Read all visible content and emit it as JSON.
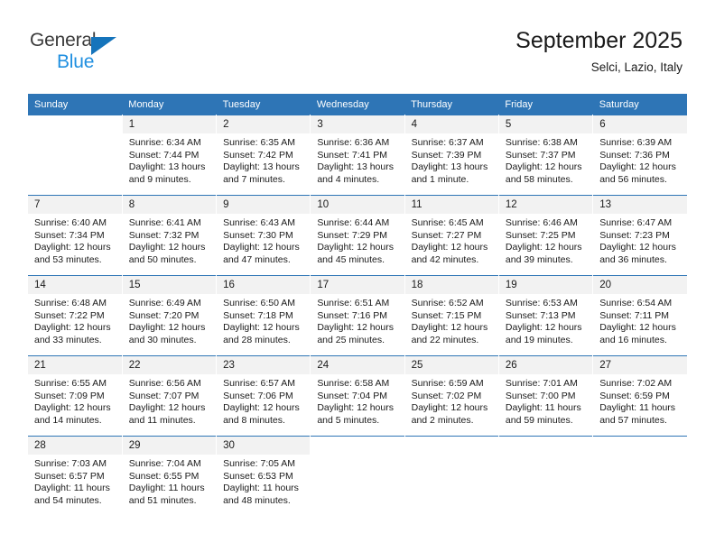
{
  "brand": {
    "name_top": "General",
    "name_bottom": "Blue",
    "accent_color": "#1574bb",
    "blue_text_color": "#1f8fe0"
  },
  "header": {
    "title": "September 2025",
    "subtitle": "Selci, Lazio, Italy"
  },
  "theme": {
    "header_bg": "#2e75b6",
    "daynum_bg": "#f2f2f2",
    "text": "#1a1a1a"
  },
  "weekday_headers": [
    "Sunday",
    "Monday",
    "Tuesday",
    "Wednesday",
    "Thursday",
    "Friday",
    "Saturday"
  ],
  "weeks": [
    [
      {
        "day": "",
        "sunrise": "",
        "sunset": "",
        "daylight_1": "",
        "daylight_2": "",
        "blank": true
      },
      {
        "day": "1",
        "sunrise": "Sunrise: 6:34 AM",
        "sunset": "Sunset: 7:44 PM",
        "daylight_1": "Daylight: 13 hours",
        "daylight_2": "and 9 minutes."
      },
      {
        "day": "2",
        "sunrise": "Sunrise: 6:35 AM",
        "sunset": "Sunset: 7:42 PM",
        "daylight_1": "Daylight: 13 hours",
        "daylight_2": "and 7 minutes."
      },
      {
        "day": "3",
        "sunrise": "Sunrise: 6:36 AM",
        "sunset": "Sunset: 7:41 PM",
        "daylight_1": "Daylight: 13 hours",
        "daylight_2": "and 4 minutes."
      },
      {
        "day": "4",
        "sunrise": "Sunrise: 6:37 AM",
        "sunset": "Sunset: 7:39 PM",
        "daylight_1": "Daylight: 13 hours",
        "daylight_2": "and 1 minute."
      },
      {
        "day": "5",
        "sunrise": "Sunrise: 6:38 AM",
        "sunset": "Sunset: 7:37 PM",
        "daylight_1": "Daylight: 12 hours",
        "daylight_2": "and 58 minutes."
      },
      {
        "day": "6",
        "sunrise": "Sunrise: 6:39 AM",
        "sunset": "Sunset: 7:36 PM",
        "daylight_1": "Daylight: 12 hours",
        "daylight_2": "and 56 minutes."
      }
    ],
    [
      {
        "day": "7",
        "sunrise": "Sunrise: 6:40 AM",
        "sunset": "Sunset: 7:34 PM",
        "daylight_1": "Daylight: 12 hours",
        "daylight_2": "and 53 minutes."
      },
      {
        "day": "8",
        "sunrise": "Sunrise: 6:41 AM",
        "sunset": "Sunset: 7:32 PM",
        "daylight_1": "Daylight: 12 hours",
        "daylight_2": "and 50 minutes."
      },
      {
        "day": "9",
        "sunrise": "Sunrise: 6:43 AM",
        "sunset": "Sunset: 7:30 PM",
        "daylight_1": "Daylight: 12 hours",
        "daylight_2": "and 47 minutes."
      },
      {
        "day": "10",
        "sunrise": "Sunrise: 6:44 AM",
        "sunset": "Sunset: 7:29 PM",
        "daylight_1": "Daylight: 12 hours",
        "daylight_2": "and 45 minutes."
      },
      {
        "day": "11",
        "sunrise": "Sunrise: 6:45 AM",
        "sunset": "Sunset: 7:27 PM",
        "daylight_1": "Daylight: 12 hours",
        "daylight_2": "and 42 minutes."
      },
      {
        "day": "12",
        "sunrise": "Sunrise: 6:46 AM",
        "sunset": "Sunset: 7:25 PM",
        "daylight_1": "Daylight: 12 hours",
        "daylight_2": "and 39 minutes."
      },
      {
        "day": "13",
        "sunrise": "Sunrise: 6:47 AM",
        "sunset": "Sunset: 7:23 PM",
        "daylight_1": "Daylight: 12 hours",
        "daylight_2": "and 36 minutes."
      }
    ],
    [
      {
        "day": "14",
        "sunrise": "Sunrise: 6:48 AM",
        "sunset": "Sunset: 7:22 PM",
        "daylight_1": "Daylight: 12 hours",
        "daylight_2": "and 33 minutes."
      },
      {
        "day": "15",
        "sunrise": "Sunrise: 6:49 AM",
        "sunset": "Sunset: 7:20 PM",
        "daylight_1": "Daylight: 12 hours",
        "daylight_2": "and 30 minutes."
      },
      {
        "day": "16",
        "sunrise": "Sunrise: 6:50 AM",
        "sunset": "Sunset: 7:18 PM",
        "daylight_1": "Daylight: 12 hours",
        "daylight_2": "and 28 minutes."
      },
      {
        "day": "17",
        "sunrise": "Sunrise: 6:51 AM",
        "sunset": "Sunset: 7:16 PM",
        "daylight_1": "Daylight: 12 hours",
        "daylight_2": "and 25 minutes."
      },
      {
        "day": "18",
        "sunrise": "Sunrise: 6:52 AM",
        "sunset": "Sunset: 7:15 PM",
        "daylight_1": "Daylight: 12 hours",
        "daylight_2": "and 22 minutes."
      },
      {
        "day": "19",
        "sunrise": "Sunrise: 6:53 AM",
        "sunset": "Sunset: 7:13 PM",
        "daylight_1": "Daylight: 12 hours",
        "daylight_2": "and 19 minutes."
      },
      {
        "day": "20",
        "sunrise": "Sunrise: 6:54 AM",
        "sunset": "Sunset: 7:11 PM",
        "daylight_1": "Daylight: 12 hours",
        "daylight_2": "and 16 minutes."
      }
    ],
    [
      {
        "day": "21",
        "sunrise": "Sunrise: 6:55 AM",
        "sunset": "Sunset: 7:09 PM",
        "daylight_1": "Daylight: 12 hours",
        "daylight_2": "and 14 minutes."
      },
      {
        "day": "22",
        "sunrise": "Sunrise: 6:56 AM",
        "sunset": "Sunset: 7:07 PM",
        "daylight_1": "Daylight: 12 hours",
        "daylight_2": "and 11 minutes."
      },
      {
        "day": "23",
        "sunrise": "Sunrise: 6:57 AM",
        "sunset": "Sunset: 7:06 PM",
        "daylight_1": "Daylight: 12 hours",
        "daylight_2": "and 8 minutes."
      },
      {
        "day": "24",
        "sunrise": "Sunrise: 6:58 AM",
        "sunset": "Sunset: 7:04 PM",
        "daylight_1": "Daylight: 12 hours",
        "daylight_2": "and 5 minutes."
      },
      {
        "day": "25",
        "sunrise": "Sunrise: 6:59 AM",
        "sunset": "Sunset: 7:02 PM",
        "daylight_1": "Daylight: 12 hours",
        "daylight_2": "and 2 minutes."
      },
      {
        "day": "26",
        "sunrise": "Sunrise: 7:01 AM",
        "sunset": "Sunset: 7:00 PM",
        "daylight_1": "Daylight: 11 hours",
        "daylight_2": "and 59 minutes."
      },
      {
        "day": "27",
        "sunrise": "Sunrise: 7:02 AM",
        "sunset": "Sunset: 6:59 PM",
        "daylight_1": "Daylight: 11 hours",
        "daylight_2": "and 57 minutes."
      }
    ],
    [
      {
        "day": "28",
        "sunrise": "Sunrise: 7:03 AM",
        "sunset": "Sunset: 6:57 PM",
        "daylight_1": "Daylight: 11 hours",
        "daylight_2": "and 54 minutes."
      },
      {
        "day": "29",
        "sunrise": "Sunrise: 7:04 AM",
        "sunset": "Sunset: 6:55 PM",
        "daylight_1": "Daylight: 11 hours",
        "daylight_2": "and 51 minutes."
      },
      {
        "day": "30",
        "sunrise": "Sunrise: 7:05 AM",
        "sunset": "Sunset: 6:53 PM",
        "daylight_1": "Daylight: 11 hours",
        "daylight_2": "and 48 minutes."
      },
      {
        "day": "",
        "sunrise": "",
        "sunset": "",
        "daylight_1": "",
        "daylight_2": "",
        "blank": true
      },
      {
        "day": "",
        "sunrise": "",
        "sunset": "",
        "daylight_1": "",
        "daylight_2": "",
        "blank": true
      },
      {
        "day": "",
        "sunrise": "",
        "sunset": "",
        "daylight_1": "",
        "daylight_2": "",
        "blank": true
      },
      {
        "day": "",
        "sunrise": "",
        "sunset": "",
        "daylight_1": "",
        "daylight_2": "",
        "blank": true
      }
    ]
  ]
}
